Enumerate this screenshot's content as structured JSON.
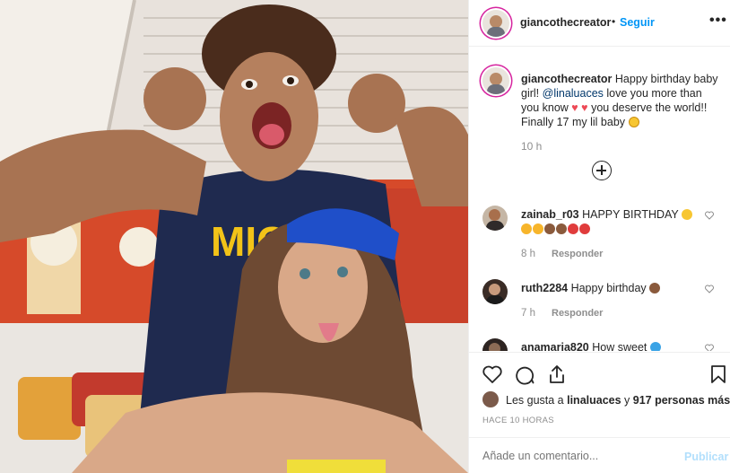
{
  "post": {
    "author": "giancothecreator",
    "follow_label": "Seguir",
    "separator": "•",
    "more_label": "•••"
  },
  "caption": {
    "username": "giancothecreator",
    "text_before_mention": " Happy birthday baby girl! ",
    "mention": "@linaluaces",
    "text_after_mention": " love you more than you know ",
    "hearts": "♥ ♥",
    "text_end": " you deserve the world!! Finally 17 my lil baby ",
    "time": "10 h",
    "emoji_icon": "grinning-face-emoji"
  },
  "comments": [
    {
      "username": "zainab_r03",
      "text": " HAPPY BIRTHDAY ",
      "time": "8 h",
      "reply_label": "Responder",
      "emojis": [
        "grinning-face-emoji",
        "heart-eyes-emoji",
        "heart-eyes-emoji",
        "cake-emoji",
        "cake-emoji",
        "balloon-emoji",
        "balloon-emoji"
      ]
    },
    {
      "username": "ruth2284",
      "text": " Happy birthday ",
      "time": "7 h",
      "reply_label": "Responder",
      "emojis": [
        "cake-emoji"
      ]
    },
    {
      "username": "anamaria820",
      "text": " How sweet ",
      "emojis": [
        "blue-heart-emoji"
      ]
    }
  ],
  "likes": {
    "prefix": "Les gusta a ",
    "user": "linaluaces",
    "middle": " y ",
    "count": "917 personas más"
  },
  "timestamp": "HACE 10 HORAS",
  "add_comment": {
    "placeholder": "Añade un comentario...",
    "publish_label": "Publicar"
  },
  "colors": {
    "accent": "#0095f6",
    "publish_disabled": "#b2dffc",
    "heart": "#ed4956",
    "muted": "#8e8e8e"
  },
  "icons": {
    "like": "heart-outline-icon",
    "comment": "comment-bubble-icon",
    "share": "share-upload-icon",
    "save": "bookmark-icon",
    "load_more": "plus-circle-icon"
  }
}
